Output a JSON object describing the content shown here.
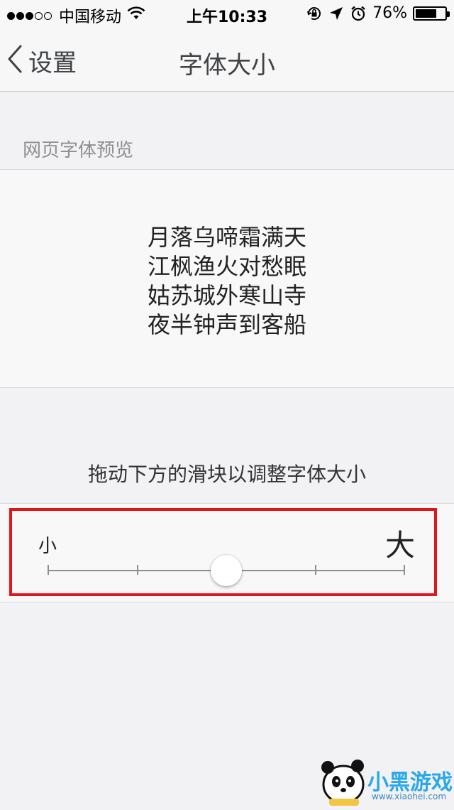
{
  "status_bar": {
    "signal_bars_full": 3,
    "signal_bars_total": 5,
    "carrier": "中国移动",
    "time": "上午10:33",
    "battery_percent": "76%",
    "battery_level": 0.76,
    "icons": [
      "wifi-icon",
      "orientation-lock-icon",
      "location-icon",
      "alarm-icon",
      "battery-icon"
    ]
  },
  "nav": {
    "back_label": "设置",
    "title": "字体大小"
  },
  "preview": {
    "section_header": "网页字体预览",
    "poem_lines": [
      "月落乌啼霜满天",
      "江枫渔火对愁眠",
      "姑苏城外寒山寺",
      "夜半钟声到客船"
    ]
  },
  "slider": {
    "instruction": "拖动下方的滑块以调整字体大小",
    "min_label": "小",
    "max_label": "大",
    "steps": 5,
    "selected_step": 3
  },
  "watermark": {
    "brand": "小黑游戏",
    "url": "www.xiaohei.com"
  },
  "colors": {
    "highlight": "#e4141b",
    "background": "#f2f2f4",
    "panel": "#f8f8f8"
  }
}
